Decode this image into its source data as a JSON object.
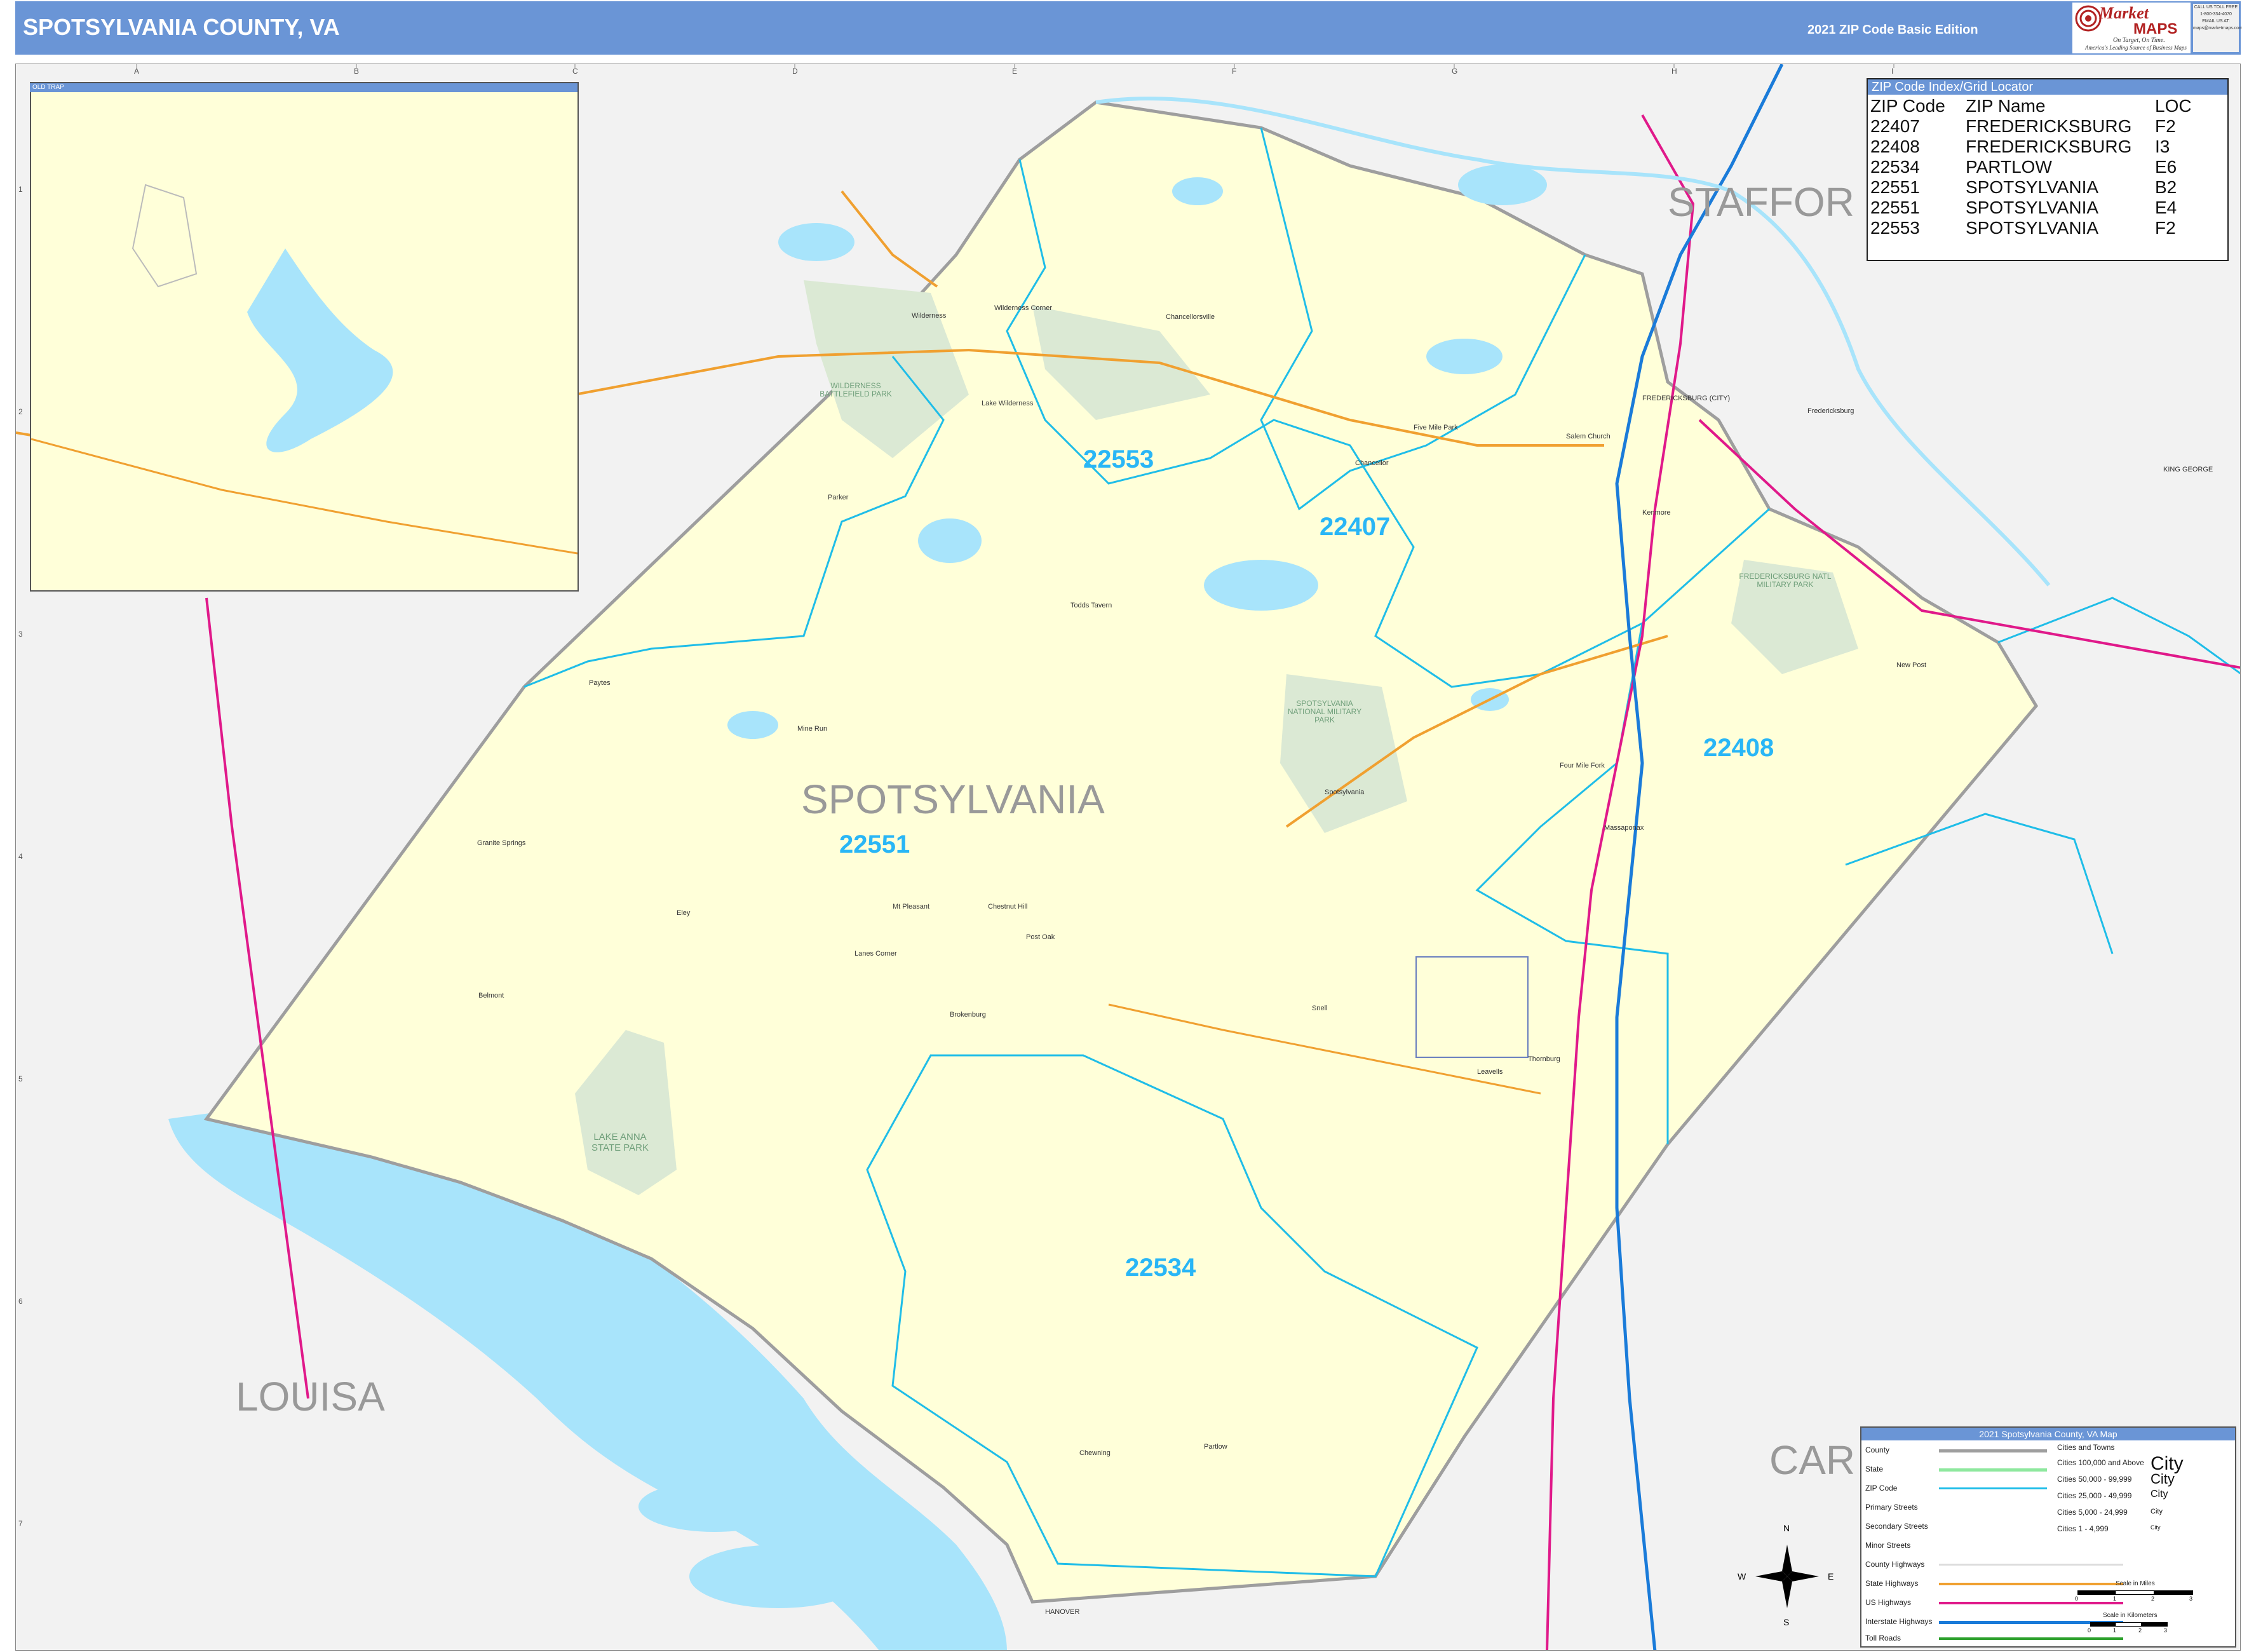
{
  "header": {
    "title": "SPOTSYLVANIA COUNTY, VA",
    "edition": "2021 ZIP Code Basic Edition",
    "logo": {
      "market": "Market",
      "maps": "MAPS",
      "tagline": "On Target, On Time.",
      "subtagline": "America's Leading Source of Business Maps"
    },
    "contact": [
      "CALL US TOLL FREE",
      "1-800-334-4070",
      "EMAIL US AT:",
      "maps@marketmaps.com"
    ]
  },
  "colors": {
    "header_bar": "#6a95d6",
    "county_fill": "#ffffd9",
    "outside_fill": "#f2f2f2",
    "water": "#a8e4fb",
    "park": "#dbe9d4",
    "zip_boundary": "#1fbde8",
    "zip_label": "#29b6f6",
    "interstate": "#1a7bd9",
    "us_highway": "#e0198a",
    "state_highway": "#f0a030",
    "county_boundary": "#9e9e9e"
  },
  "map": {
    "county_labels": [
      "SPOTSYLVANIA",
      "LOUISA",
      "STAFFOR",
      "CAR"
    ],
    "zip_labels": [
      "22553",
      "22407",
      "22408",
      "22551",
      "22534"
    ],
    "places": [
      "Wilderness",
      "Wilderness Corner",
      "Chancellorsville",
      "Lake Wilderness",
      "Fredericksburg",
      "Salem Church",
      "Five Mile Park",
      "Chancellor",
      "Kenmore",
      "Massaponax",
      "Four Mile Fork",
      "Leavells",
      "Partlow",
      "Thornburg",
      "Snell",
      "Spotsylvania",
      "Post Oak",
      "Brokenburg",
      "Lanes Corner",
      "Belmont",
      "Paytes",
      "Granite Springs",
      "Mine Run",
      "Todds Tavern",
      "Parker",
      "Eley",
      "Chewning",
      "Chestnut Hill",
      "Mt Pleasant",
      "New Post"
    ],
    "parks": [
      "WILDERNESS BATTLEFIELD PARK",
      "SPOTSYLVANIA NATIONAL MILITARY PARK",
      "FREDERICKSBURG NATL MILITARY PARK",
      "LAKE ANNA STATE PARK"
    ],
    "small_labels": [
      "FREDERICKSBURG (CITY)",
      "HANOVER",
      "KING GEORGE"
    ],
    "inset_label": "OLD TRAP",
    "grid_cols": [
      "A",
      "B",
      "C",
      "D",
      "E",
      "F",
      "G",
      "H",
      "I"
    ],
    "grid_rows": [
      "1",
      "2",
      "3",
      "4",
      "5",
      "6",
      "7"
    ]
  },
  "zip_index": {
    "title": "ZIP Code Index/Grid Locator",
    "headers": [
      "ZIP Code",
      "ZIP Name",
      "LOC"
    ],
    "rows": [
      [
        "22407",
        "FREDERICKSBURG",
        "F2"
      ],
      [
        "22408",
        "FREDERICKSBURG",
        "I3"
      ],
      [
        "22534",
        "PARTLOW",
        "E6"
      ],
      [
        "22551",
        "SPOTSYLVANIA",
        "B2"
      ],
      [
        "22551",
        "SPOTSYLVANIA",
        "E4"
      ],
      [
        "22553",
        "SPOTSYLVANIA",
        "F2"
      ]
    ]
  },
  "legend": {
    "title": "2021 Spotsylvania County, VA Map",
    "items": [
      "County",
      "State",
      "ZIP Code",
      "Primary Streets",
      "Secondary Streets",
      "Minor Streets",
      "County Highways",
      "State Highways",
      "US Highways",
      "Interstate Highways",
      "Toll Roads"
    ],
    "cities_title": "Cities and Towns",
    "cities": [
      {
        "range": "Cities 100,000 and Above",
        "sample": "City"
      },
      {
        "range": "Cities 50,000 - 99,999",
        "sample": "City"
      },
      {
        "range": "Cities 25,000 - 49,999",
        "sample": "City"
      },
      {
        "range": "Cities 5,000 - 24,999",
        "sample": "City"
      },
      {
        "range": "Cities 1 - 4,999",
        "sample": "City"
      }
    ],
    "scale_miles": "Scale in Miles",
    "scale_km": "Scale in Kilometers",
    "scale_miles_ticks": [
      "0",
      "1",
      "2",
      "3"
    ],
    "scale_km_ticks": [
      "0",
      "1",
      "2",
      "3"
    ],
    "compass": [
      "N",
      "S",
      "E",
      "W"
    ]
  }
}
